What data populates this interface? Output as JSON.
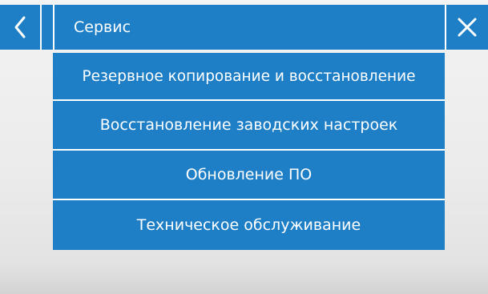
{
  "header": {
    "title": "Сервис",
    "back_icon": "chevron-left-icon",
    "close_icon": "close-icon",
    "color": "#1e7fc7"
  },
  "menu": {
    "items": [
      {
        "label": "Резервное копирование и восстановление"
      },
      {
        "label": "Восстановление заводских настроек"
      },
      {
        "label": "Обновление ПО"
      },
      {
        "label": "Техническое обслуживание"
      }
    ]
  }
}
